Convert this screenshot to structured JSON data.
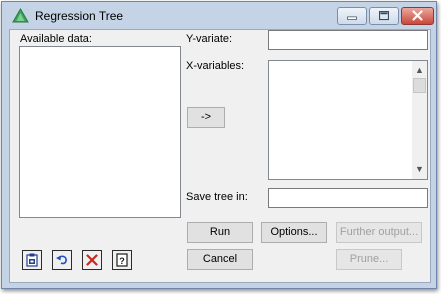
{
  "window": {
    "title": "Regression Tree"
  },
  "caption_buttons": {
    "minimize": "minimize",
    "maximize": "maximize",
    "close": "close"
  },
  "form": {
    "available_data_label": "Available data:",
    "y_variate_label": "Y-variate:",
    "y_variate_value": "",
    "x_variables_label": "X-variables:",
    "x_variables_items": [],
    "available_data_items": [],
    "add_arrow_label": "->",
    "save_tree_label": "Save tree in:",
    "save_tree_value": ""
  },
  "buttons": {
    "run": "Run",
    "options": "Options...",
    "further_output": "Further output...",
    "cancel": "Cancel",
    "prune": "Prune..."
  },
  "toolbar": {
    "icons": [
      "clipboard-icon",
      "undo-icon",
      "clear-icon",
      "help-icon"
    ]
  },
  "colors": {
    "frame": "#c4d3e6",
    "client_bg": "#f0f0f0",
    "close_button": "#c9483a",
    "app_icon": "#3aa05c"
  }
}
